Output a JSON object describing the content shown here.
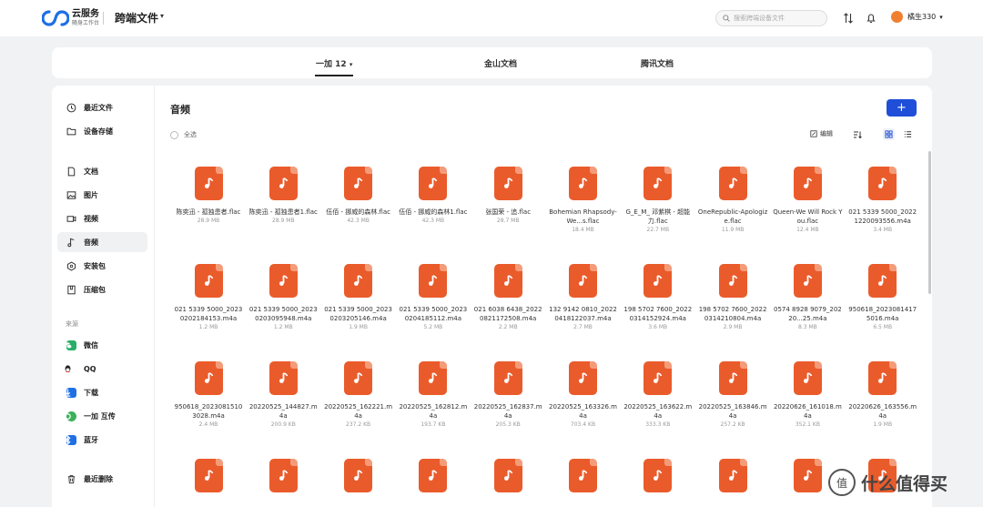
{
  "brand": {
    "name": "云服务",
    "sub": "随身工作台"
  },
  "app_title": "跨端文件",
  "search": {
    "placeholder": "搜索跨端设备文件"
  },
  "user": {
    "name": "橘生330"
  },
  "device_tabs": [
    {
      "label": "一加 12",
      "active": true
    },
    {
      "label": "金山文档",
      "active": false
    },
    {
      "label": "腾讯文档",
      "active": false
    }
  ],
  "sidebar": {
    "top": [
      {
        "label": "最近文件",
        "icon": "clock-icon"
      },
      {
        "label": "设备存储",
        "icon": "folder-icon"
      }
    ],
    "categories": [
      {
        "label": "文档",
        "icon": "document-icon"
      },
      {
        "label": "图片",
        "icon": "image-icon"
      },
      {
        "label": "视频",
        "icon": "video-icon"
      },
      {
        "label": "音频",
        "icon": "music-icon",
        "active": true
      },
      {
        "label": "安装包",
        "icon": "package-icon"
      },
      {
        "label": "压缩包",
        "icon": "archive-icon"
      }
    ],
    "source_label": "来源",
    "sources": [
      {
        "label": "微信",
        "icon": "wechat-icon",
        "color": "#2aae67"
      },
      {
        "label": "QQ",
        "icon": "qq-icon",
        "color": "#222222"
      },
      {
        "label": "下载",
        "icon": "download-icon",
        "color": "#1f6fe5"
      },
      {
        "label": "一加 互传",
        "icon": "share-icon",
        "color": "#3bb15a"
      },
      {
        "label": "蓝牙",
        "icon": "bluetooth-icon",
        "color": "#1f6fe5"
      }
    ],
    "trash": {
      "label": "最近删除",
      "icon": "trash-icon"
    }
  },
  "content": {
    "title": "音频",
    "add_label": "+",
    "select_all": "全选",
    "edit_label": "编辑"
  },
  "files": [
    {
      "name": "陈奕迅 - 孤独患者.flac",
      "size": "28.9 MB"
    },
    {
      "name": "陈奕迅 - 孤独患者1.flac",
      "size": "28.9 MB"
    },
    {
      "name": "伍佰 - 挪威的森林.flac",
      "size": "42.3 MB"
    },
    {
      "name": "伍佰 - 挪威的森林1.flac",
      "size": "42.3 MB"
    },
    {
      "name": "张国荣 - 追.flac",
      "size": "28.7 MB"
    },
    {
      "name": "Bohemian Rhapsody-We...s.flac",
      "size": "18.4 MB"
    },
    {
      "name": "G_E_M_ 邓紫棋 - 超能力.flac",
      "size": "22.7 MB"
    },
    {
      "name": "OneRepublic-Apologize.flac",
      "size": "11.9 MB"
    },
    {
      "name": "Queen-We Will Rock You.flac",
      "size": "12.4 MB"
    },
    {
      "name": "021 5339 5000_20221220093556.m4a",
      "size": "3.4 MB"
    },
    {
      "name": "021 5339 5000_20230202184153.m4a",
      "size": "1.2 MB"
    },
    {
      "name": "021 5339 5000_20230203095948.m4a",
      "size": "1.2 MB"
    },
    {
      "name": "021 5339 5000_20230203205146.m4a",
      "size": "1.9 MB"
    },
    {
      "name": "021 5339 5000_20230204185112.m4a",
      "size": "5.2 MB"
    },
    {
      "name": "021 6038 6438_20220821172508.m4a",
      "size": "2.2 MB"
    },
    {
      "name": "132 9142 0810_20220418122037.m4a",
      "size": "2.7 MB"
    },
    {
      "name": "198 5702 7600_20220314152924.m4a",
      "size": "3.6 MB"
    },
    {
      "name": "198 5702 7600_20220314210804.m4a",
      "size": "2.9 MB"
    },
    {
      "name": "0574 8928 9079_20220...25.m4a",
      "size": "8.3 MB"
    },
    {
      "name": "950618_20230814175016.m4a",
      "size": "6.5 MB"
    },
    {
      "name": "950618_20230815103028.m4a",
      "size": "2.4 MB"
    },
    {
      "name": "20220525_144827.m4a",
      "size": "200.9 KB"
    },
    {
      "name": "20220525_162221.m4a",
      "size": "237.2 KB"
    },
    {
      "name": "20220525_162812.m4a",
      "size": "193.7 KB"
    },
    {
      "name": "20220525_162837.m4a",
      "size": "205.3 KB"
    },
    {
      "name": "20220525_163326.m4a",
      "size": "703.4 KB"
    },
    {
      "name": "20220525_163622.m4a",
      "size": "333.3 KB"
    },
    {
      "name": "20220525_163846.m4a",
      "size": "257.2 KB"
    },
    {
      "name": "20220626_161018.m4a",
      "size": "352.1 KB"
    },
    {
      "name": "20220626_163556.m4a",
      "size": "1.9 MB"
    },
    {
      "name": "",
      "size": ""
    },
    {
      "name": "",
      "size": ""
    },
    {
      "name": "",
      "size": ""
    },
    {
      "name": "",
      "size": ""
    },
    {
      "name": "",
      "size": ""
    },
    {
      "name": "",
      "size": ""
    },
    {
      "name": "",
      "size": ""
    },
    {
      "name": "",
      "size": ""
    },
    {
      "name": "",
      "size": ""
    },
    {
      "name": "",
      "size": ""
    }
  ],
  "watermark": {
    "text": "值 | 什么值得买"
  },
  "colors": {
    "accent": "#1f4fd8",
    "audio_icon": "#ea5b2b"
  }
}
